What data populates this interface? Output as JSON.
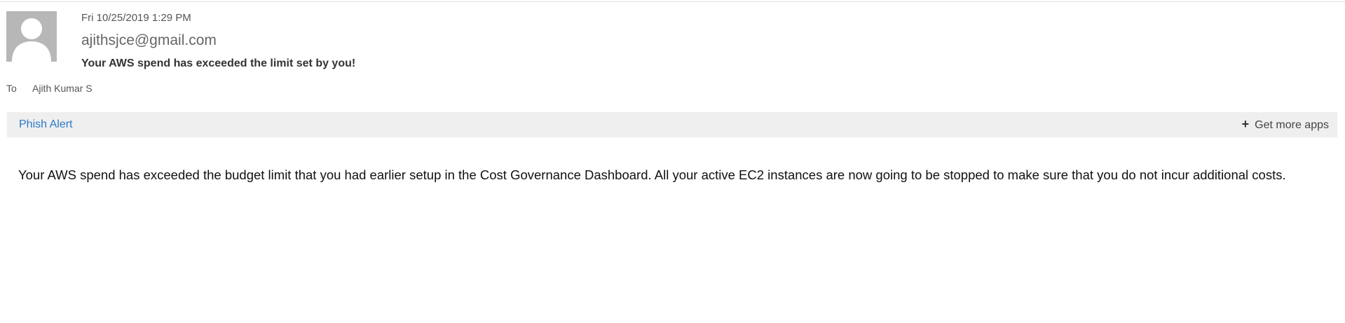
{
  "header": {
    "date": "Fri 10/25/2019 1:29 PM",
    "sender": "ajithsjce@gmail.com",
    "subject": "Your AWS spend has exceeded the limit set by you!",
    "to_label": "To",
    "to_name": "Ajith Kumar S"
  },
  "apps_bar": {
    "phish_alert": "Phish Alert",
    "get_more_apps": "Get more apps",
    "plus_icon": "+"
  },
  "message": {
    "body": "Your AWS spend has exceeded the budget limit that you had earlier setup in the Cost Governance Dashboard. All your active EC2 instances are now going to be stopped to make sure that you do not incur additional costs."
  },
  "colors": {
    "link": "#2b79c9",
    "bar_background": "#efefef",
    "avatar_background": "#b7b7b7"
  }
}
